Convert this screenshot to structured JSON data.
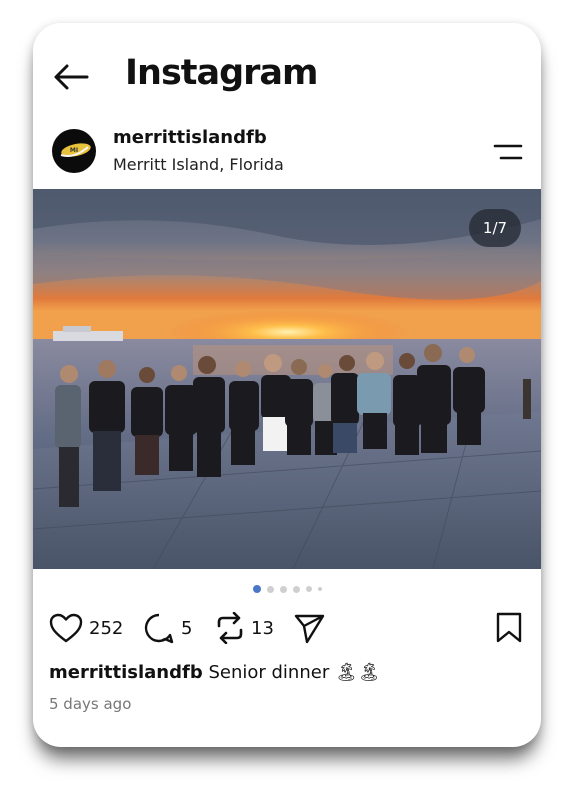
{
  "header": {
    "logo_text": "Instagram",
    "back_icon": "arrow-left-icon"
  },
  "post": {
    "username": "merrittislandfb",
    "location": "Merritt Island, Florida",
    "image_counter": "1/7",
    "image_subject": "sunset group photo",
    "carousel": {
      "total_dots": 6,
      "active_index": 0
    },
    "likes": "252",
    "comments": "5",
    "reposts": "13",
    "caption_user": "merrittislandfb",
    "caption_text": "Senior dinner",
    "caption_emoji": "🏝🏝",
    "timestamp": "5 days ago"
  },
  "colors": {
    "accent_dot": "#4a78c6",
    "text": "#111111",
    "muted": "#777777"
  }
}
